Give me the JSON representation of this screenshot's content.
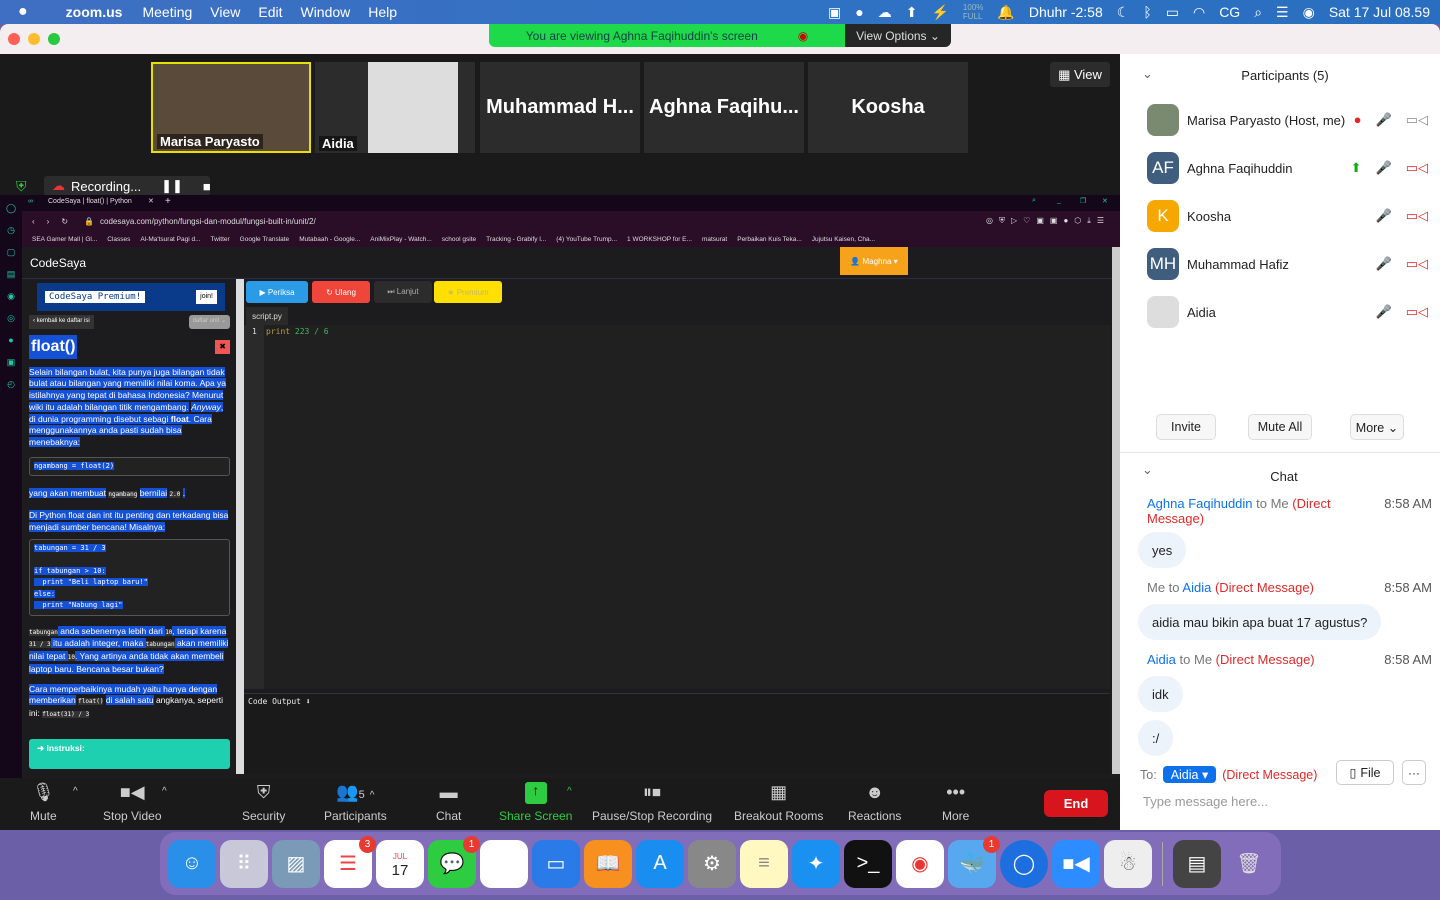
{
  "menubar": {
    "apple": "",
    "app": "zoom.us",
    "items": [
      "Meeting",
      "View",
      "Edit",
      "Window",
      "Help"
    ],
    "battery_small": "100%",
    "battery_small2": "FULL",
    "prayer": "Dhuhr -2:58",
    "user": "CG",
    "datetime": "Sat 17 Jul  08.59"
  },
  "banner": {
    "text": "You are viewing Aghna Faqihuddin's screen",
    "view_options": "View Options ⌄"
  },
  "thumbs": [
    {
      "name": "Marisa Paryasto"
    },
    {
      "name": "Aidia"
    },
    {
      "name": "Muhammad H..."
    },
    {
      "name": "Aghna Faqihu..."
    },
    {
      "name": "Koosha"
    }
  ],
  "view_label": "View",
  "recording": {
    "label": "Recording..."
  },
  "browser": {
    "tab": "CodeSaya | float() | Python",
    "url": "codesaya.com/python/fungsi-dan-modul/fungsi-built-in/unit/2/",
    "bookmarks": [
      "SEA Gamer Mall | Gl...",
      "Classes",
      "Al-Ma'tsurat Pagi d...",
      "Twitter",
      "Google Translate",
      "Mutabaah - Google...",
      "AniMixPlay - Watch...",
      "school gsite",
      "Tracking - Grabify l...",
      "(4) YouTube Trump...",
      "1 WORKSHOP for E...",
      "matsurat",
      "Perbaikan Kuis Teka...",
      "Jujutsu Kaisen, Cha..."
    ]
  },
  "site": {
    "brand": "CodeSaya",
    "user": "Maghna",
    "premium_banner": "CodeSaya Premium!",
    "join": "join!",
    "back": "kembali ke daftar isi",
    "unit_list": "daftar unit",
    "title": "float()",
    "p1": "Selain bilangan bulat, kita punya juga bilangan tidak bulat atau bilangan yang memiliki nilai koma. Apa ya istilahnya yang tepat di bahasa Indonesia? Menurut wiki itu adalah bilangan titik mengambang.",
    "p1_em": "Anyway",
    "p1b": ", di dunia programming disebut sebagi ",
    "p1_bold": "float",
    "p1c": ". Cara menggunakannya anda pasti sudah bisa menebaknya:",
    "code1": "ngambang = float(2)",
    "p2a": "yang akan membuat",
    "p2code": "ngambang",
    "p2b": "bernilai",
    "p2val": "2.0",
    "p2c": ".",
    "p3": "Di Python float dan int itu penting dan terkadang bisa menjadi sumber bencana! Misalnya:",
    "code2": [
      "tabungan = 31 / 3",
      "",
      "if tabungan > 10:",
      "  print \"Beli laptop baru!\"",
      "else:",
      "  print \"Nabung lagi\""
    ],
    "p4": [
      {
        "c": "tabungan"
      },
      {
        "t": " anda sebenernya lebih dari "
      },
      {
        "c": "10"
      },
      {
        "t": ", tetapi karena "
      },
      {
        "c": "31 / 3"
      },
      {
        "t": " itu adalah integer, maka "
      },
      {
        "c": "tabungan"
      },
      {
        "t": " akan memiliki nilai tepat "
      },
      {
        "c": "10"
      },
      {
        "t": ". Yang artinya anda tidak akan membeli laptop baru. Bencana besar bukan?"
      }
    ],
    "p5a": "Cara memperbaikinya mudah yaitu hanya dengan memberikan",
    "p5code": "float()",
    "p5b": "di salah satu",
    "p5c": "angkanya, seperti ini:",
    "p5code2": "float(31) / 3",
    "instruksi": "➜ Instruksi:",
    "buttons": {
      "check": "▶ Periksa",
      "reset": "↻ Ulang",
      "next": "⏭ Lanjut",
      "premium": "★ Premium"
    },
    "file_tab": "script.py",
    "line_no": "1",
    "code_kw": "print",
    "code_rest": " 223 / 6",
    "output_label": "Code Output ⬇"
  },
  "toolbar": {
    "mute": "Mute",
    "video": "Stop Video",
    "security": "Security",
    "participants": "Participants",
    "participants_count": "5",
    "chat": "Chat",
    "share": "Share Screen",
    "record": "Pause/Stop Recording",
    "breakout": "Breakout Rooms",
    "reactions": "Reactions",
    "more": "More",
    "end": "End"
  },
  "panel": {
    "title": "Participants (5)",
    "participants": [
      {
        "name": "Marisa Paryasto  (Host, me)",
        "initials": "",
        "color": "#7a8a70"
      },
      {
        "name": "Aghna Faqihuddin",
        "initials": "AF",
        "color": "#3f5d7c"
      },
      {
        "name": "Koosha",
        "initials": "K",
        "color": "#f7a800"
      },
      {
        "name": "Muhammad Hafiz",
        "initials": "MH",
        "color": "#3f5d7c"
      },
      {
        "name": "Aidia",
        "initials": "",
        "color": "#ddd"
      }
    ],
    "invite": "Invite",
    "mute_all": "Mute All",
    "more": "More ⌄",
    "chat_title": "Chat",
    "messages": [
      {
        "from": "Aghna Faqihuddin",
        "to": " to Me ",
        "dm": "(Direct Message)",
        "time": "8:58 AM",
        "texts": [
          "yes"
        ]
      },
      {
        "from": "Me to ",
        "to": "Aidia",
        "dm": " (Direct Message)",
        "time": "8:58 AM",
        "texts": [
          "aidia mau bikin apa buat 17 agustus?"
        ]
      },
      {
        "from": "Aidia",
        "to": " to Me ",
        "dm": "(Direct Message)",
        "time": "8:58 AM",
        "texts": [
          "idk",
          ":/"
        ]
      }
    ],
    "to_label": "To:",
    "to_value": "Aidia ▾",
    "to_dm": "(Direct Message)",
    "file": "File",
    "more_dots": "···",
    "placeholder": "Type message here..."
  },
  "dock": {
    "calendar_month": "JUL",
    "calendar_day": "17",
    "badges": {
      "reminders": "3",
      "messages": "1",
      "chrome_ext": "1"
    }
  }
}
